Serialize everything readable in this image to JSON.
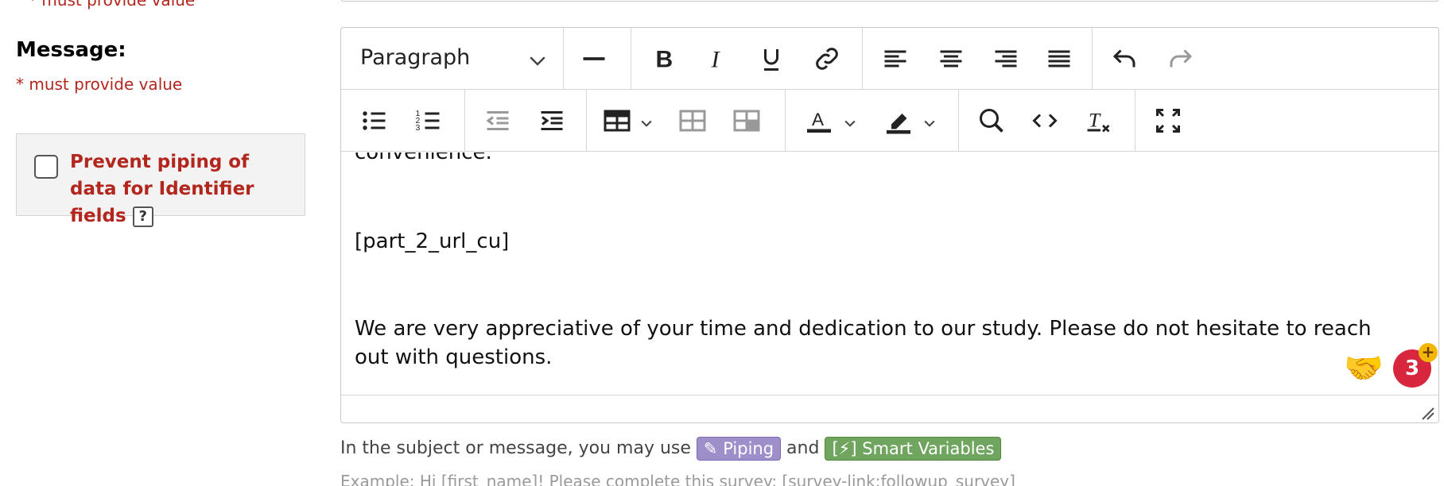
{
  "top": {
    "required_note": "* must provide value"
  },
  "field": {
    "label": "Message:",
    "required_note": "* must provide value"
  },
  "piping_option": {
    "label": "Prevent piping of data for Identifier fields",
    "help": "?"
  },
  "toolbar": {
    "block_format": "Paragraph"
  },
  "content": {
    "line1": "convenience.",
    "line2": "[part_2_url_cu]",
    "line3": "We are very appreciative of your time and dedication to our study. Please do not hesitate to reach out with questions."
  },
  "widgets": {
    "badge_count": "3",
    "badge_plus": "+"
  },
  "helper": {
    "prefix": "In the subject or message, you may use",
    "piping_label": "Piping",
    "and": "and",
    "smart_label": "[⚡] Smart Variables"
  },
  "example": "Example: Hi [first_name]! Please complete this survey: [survey-link:followup_survey]",
  "colors": {
    "required": "#b3261e",
    "piping": "#9e8ec9",
    "smart": "#6fa55f",
    "badge": "#d7263d"
  }
}
